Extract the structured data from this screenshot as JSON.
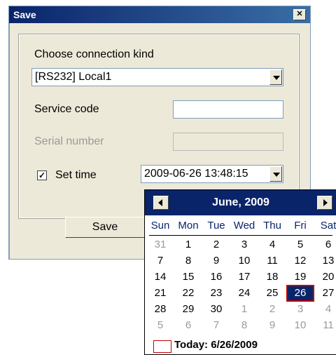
{
  "window": {
    "title": "Save"
  },
  "form": {
    "connection_kind_label": "Choose connection kind",
    "connection_kind_value": "[RS232] Local1",
    "service_code_label": "Service code",
    "service_code_value": "",
    "serial_number_label": "Serial number",
    "serial_number_value": "",
    "set_time_label": "Set time",
    "set_time_checked": true,
    "set_time_value": "2009-06-26 13:48:15",
    "save_label": "Save"
  },
  "calendar": {
    "month_title": "June, 2009",
    "weekdays": [
      "Sun",
      "Mon",
      "Tue",
      "Wed",
      "Thu",
      "Fri",
      "Sat"
    ],
    "weeks": [
      [
        "31",
        "1",
        "2",
        "3",
        "4",
        "5",
        "6"
      ],
      [
        "7",
        "8",
        "9",
        "10",
        "11",
        "12",
        "13"
      ],
      [
        "14",
        "15",
        "16",
        "17",
        "18",
        "19",
        "20"
      ],
      [
        "21",
        "22",
        "23",
        "24",
        "25",
        "26",
        "27"
      ],
      [
        "28",
        "29",
        "30",
        "1",
        "2",
        "3",
        "4"
      ],
      [
        "5",
        "6",
        "7",
        "8",
        "9",
        "10",
        "11"
      ]
    ],
    "selected": "26",
    "today_text": "Today: 6/26/2009"
  },
  "icons": {
    "close": "close-icon",
    "dropdown": "chevron-down-icon",
    "prev": "chevron-left-icon",
    "next": "chevron-right-icon"
  },
  "colors": {
    "title_bar": "#0a246a",
    "dialog_bg": "#ece9d8",
    "selected_day_outline": "#c00000"
  }
}
